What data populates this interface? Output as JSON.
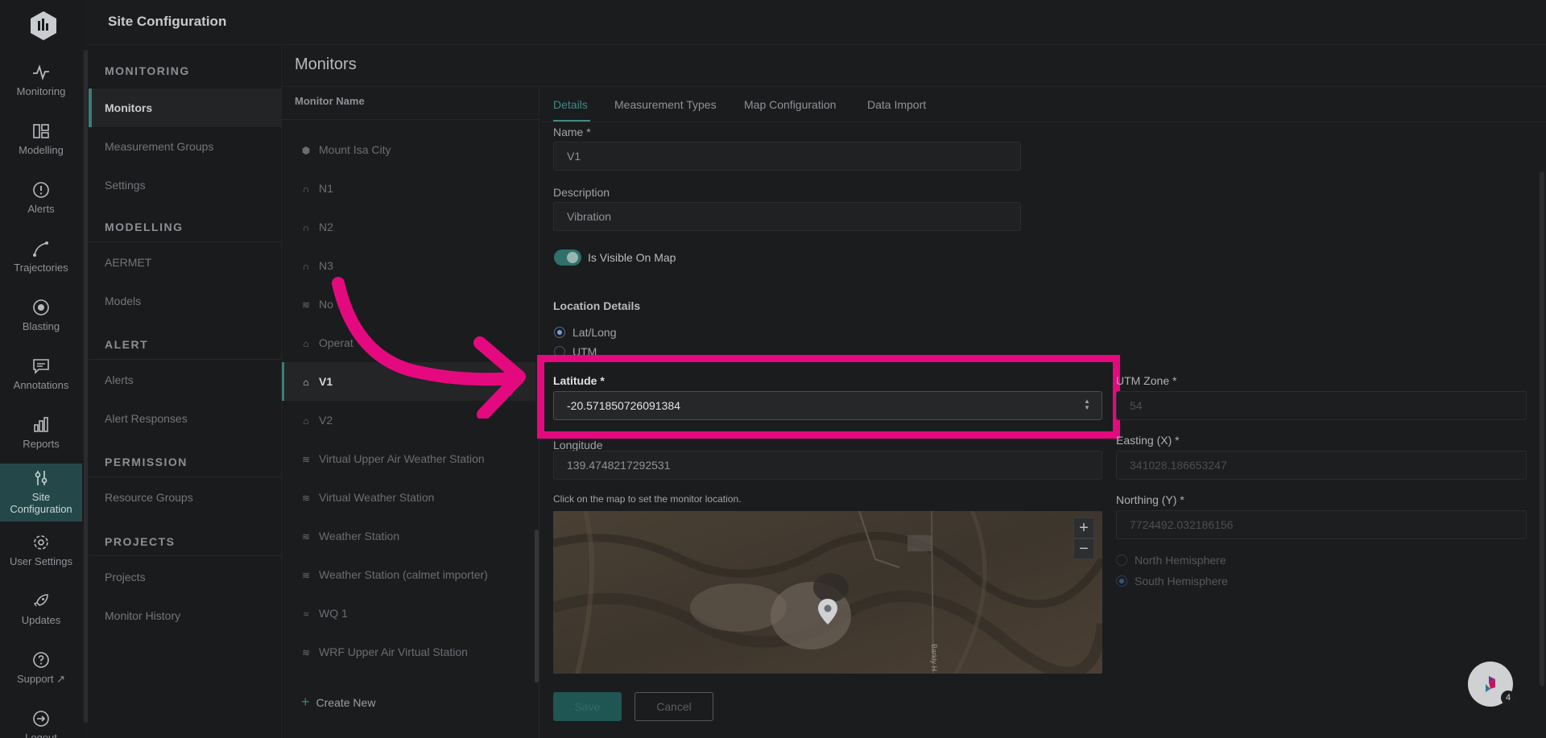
{
  "app": {
    "title": "Site Configuration"
  },
  "rail": {
    "items": [
      {
        "label": "Monitoring",
        "icon": "activity-icon"
      },
      {
        "label": "Modelling",
        "icon": "layout-icon"
      },
      {
        "label": "Alerts",
        "icon": "alert-circle-icon"
      },
      {
        "label": "Trajectories",
        "icon": "trajectory-icon"
      },
      {
        "label": "Blasting",
        "icon": "target-icon"
      },
      {
        "label": "Annotations",
        "icon": "message-icon"
      },
      {
        "label": "Reports",
        "icon": "bar-chart-icon"
      },
      {
        "label_line1": "Site",
        "label_line2": "Configuration",
        "icon": "sliders-icon",
        "active": true
      },
      {
        "label": "User Settings",
        "icon": "gear-icon"
      },
      {
        "label": "Updates",
        "icon": "rocket-icon"
      },
      {
        "label": "Support",
        "icon": "help-icon"
      },
      {
        "label": "Logout",
        "icon": "logout-icon"
      }
    ]
  },
  "subnav": {
    "monitoring_head": "MONITORING",
    "monitors": "Monitors",
    "measurement_groups": "Measurement Groups",
    "settings": "Settings",
    "modelling_head": "MODELLING",
    "aermet": "AERMET",
    "models": "Models",
    "alert_head": "ALERT",
    "alerts": "Alerts",
    "alert_responses": "Alert Responses",
    "permission_head": "PERMISSION",
    "resource_groups": "Resource Groups",
    "projects_head": "PROJECTS",
    "projects": "Projects",
    "monitor_history": "Monitor History"
  },
  "monitors": {
    "title": "Monitors",
    "column_header": "Monitor Name",
    "items": [
      {
        "name": "Mount Isa City",
        "icon": "cube-icon"
      },
      {
        "name": "N1",
        "icon": "headphones-icon"
      },
      {
        "name": "N2",
        "icon": "headphones-icon"
      },
      {
        "name": "N3",
        "icon": "headphones-icon"
      },
      {
        "name": "No",
        "icon": "wind-icon"
      },
      {
        "name": "Operat",
        "icon": "vibration-icon"
      },
      {
        "name": "V1",
        "icon": "vibration-icon",
        "active": true
      },
      {
        "name": "V2",
        "icon": "vibration-icon"
      },
      {
        "name": "Virtual Upper Air Weather Station",
        "icon": "wind-icon"
      },
      {
        "name": "Virtual Weather Station",
        "icon": "wind-icon"
      },
      {
        "name": "Weather Station",
        "icon": "wind-icon"
      },
      {
        "name": "Weather Station (calmet importer)",
        "icon": "wind-icon"
      },
      {
        "name": "WQ 1",
        "icon": "water-icon"
      },
      {
        "name": "WRF Upper Air Virtual Station",
        "icon": "wind-icon"
      }
    ],
    "create_new": "Create New"
  },
  "tabs": {
    "details": "Details",
    "measurement_types": "Measurement Types",
    "map_configuration": "Map Configuration",
    "data_import": "Data Import"
  },
  "form": {
    "name_label": "Name *",
    "name_value": "V1",
    "description_label": "Description",
    "description_value": "Vibration",
    "visible_label": "Is Visible On Map",
    "visible_on": true,
    "location_head": "Location Details",
    "latlong_label": "Lat/Long",
    "utm_label": "UTM",
    "latitude_label": "Latitude *",
    "latitude_value": "-20.571850726091384",
    "longitude_label": "Longitude",
    "longitude_value": "139.4748217292531",
    "map_hint": "Click on the map to set the monitor location.",
    "utm_zone_label": "UTM Zone *",
    "utm_zone_value": "54",
    "easting_label": "Easting (X) *",
    "easting_value": "341028.186653247",
    "northing_label": "Northing (Y) *",
    "northing_value": "7724492.032186156",
    "north_hemisphere": "North Hemisphere",
    "south_hemisphere": "South Hemisphere",
    "save": "Save",
    "cancel": "Cancel"
  },
  "map": {
    "zoom_in": "+",
    "zoom_out": "−",
    "road_label": "Barkly H"
  },
  "help": {
    "badge": "4"
  },
  "colors": {
    "accent": "#3f8b86",
    "highlight": "#e5097f"
  }
}
